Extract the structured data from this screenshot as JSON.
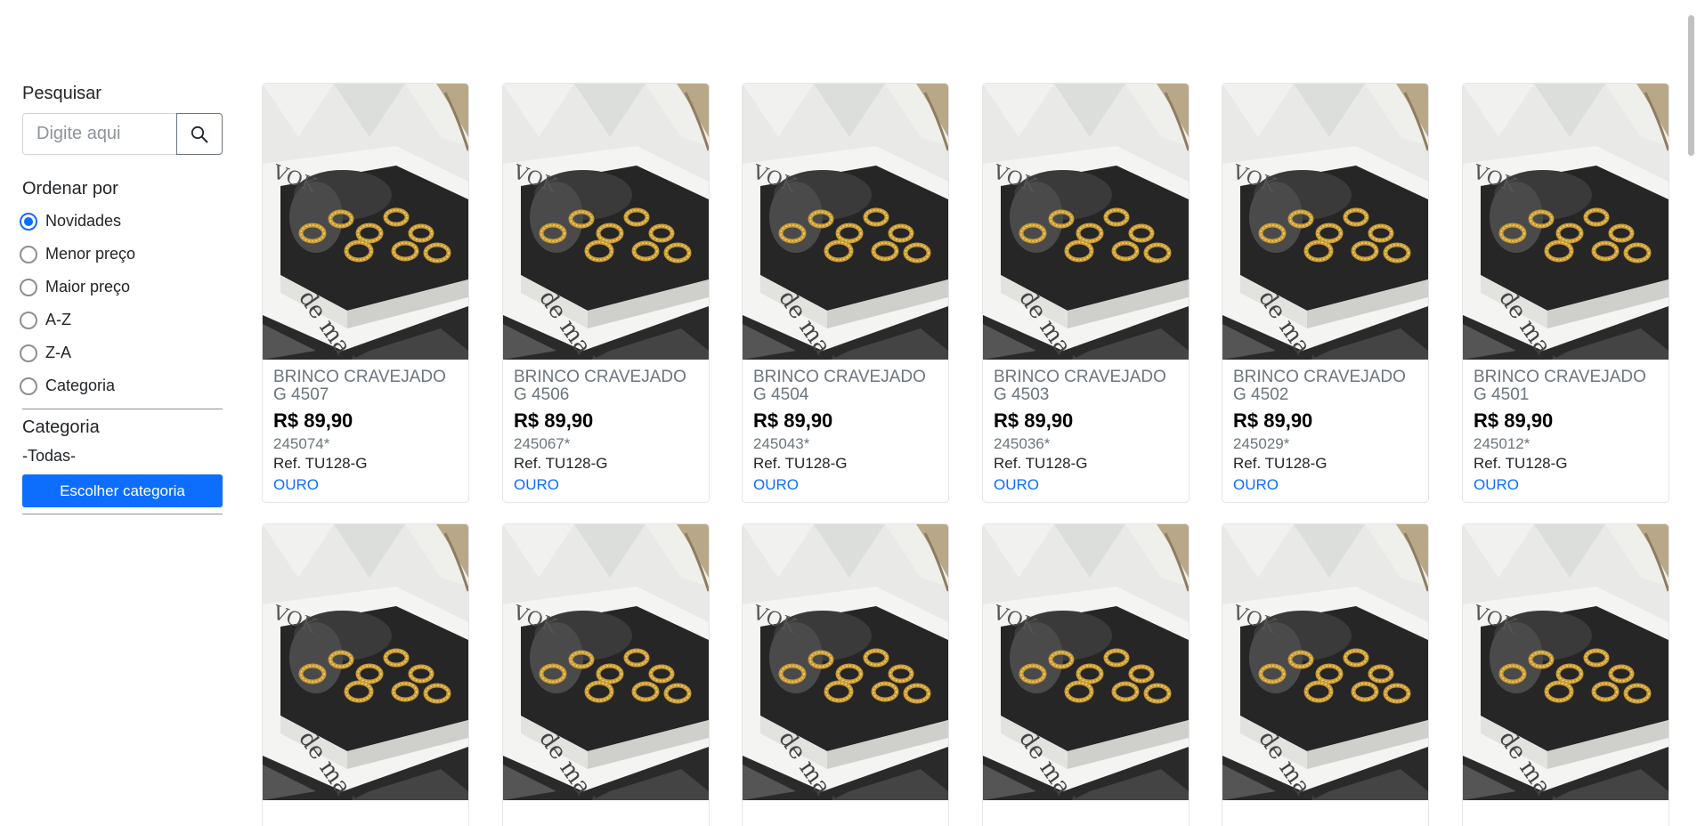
{
  "sidebar": {
    "search_title": "Pesquisar",
    "search_placeholder": "Digite aqui",
    "order_title": "Ordenar por",
    "order_options": [
      {
        "label": "Novidades",
        "checked": true
      },
      {
        "label": "Menor preço",
        "checked": false
      },
      {
        "label": "Maior preço",
        "checked": false
      },
      {
        "label": "A-Z",
        "checked": false
      },
      {
        "label": "Z-A",
        "checked": false
      },
      {
        "label": "Categoria",
        "checked": false
      }
    ],
    "category_title": "Categoria",
    "category_value": "-Todas-",
    "category_button": "Escolher categoria"
  },
  "products": [
    {
      "name": "BRINCO CRAVEJADO G 4507",
      "price": "R$ 89,90",
      "code": "245074*",
      "ref": "Ref. TU128-G",
      "material": "OURO"
    },
    {
      "name": "BRINCO CRAVEJADO G 4506",
      "price": "R$ 89,90",
      "code": "245067*",
      "ref": "Ref. TU128-G",
      "material": "OURO"
    },
    {
      "name": "BRINCO CRAVEJADO G 4504",
      "price": "R$ 89,90",
      "code": "245043*",
      "ref": "Ref. TU128-G",
      "material": "OURO"
    },
    {
      "name": "BRINCO CRAVEJADO G 4503",
      "price": "R$ 89,90",
      "code": "245036*",
      "ref": "Ref. TU128-G",
      "material": "OURO"
    },
    {
      "name": "BRINCO CRAVEJADO G 4502",
      "price": "R$ 89,90",
      "code": "245029*",
      "ref": "Ref. TU128-G",
      "material": "OURO"
    },
    {
      "name": "BRINCO CRAVEJADO G 4501",
      "price": "R$ 89,90",
      "code": "245012*",
      "ref": "Ref. TU128-G",
      "material": "OURO"
    }
  ],
  "second_row_count": 6,
  "colors": {
    "accent": "#0d6efd",
    "muted": "#6c757d"
  },
  "icons": {
    "search": "search-icon",
    "product_image": "product-photo-icon"
  }
}
